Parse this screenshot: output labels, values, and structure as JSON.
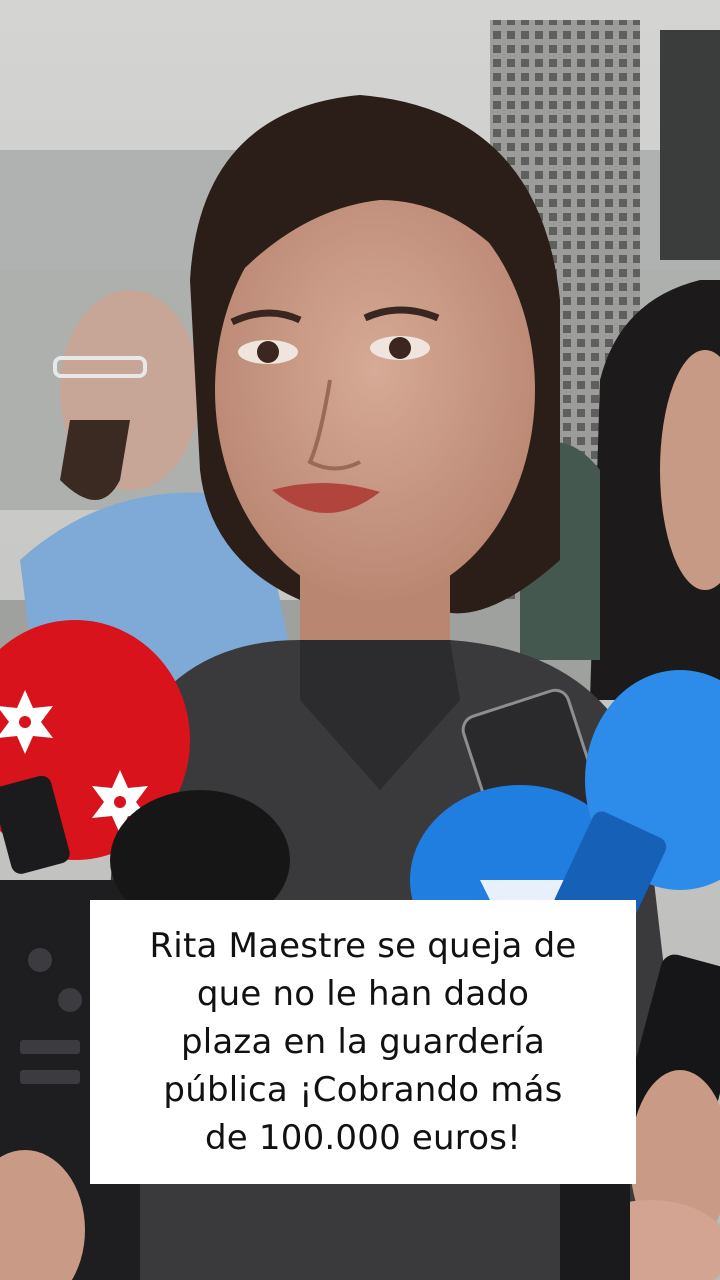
{
  "scene": {
    "description_hidden": "",
    "colors": {
      "wall": "#c9c9c8",
      "hair": "#2b1d17",
      "skin": "#c99a86",
      "shirt": "#3a3a3c",
      "mic_red": "#d8131b",
      "mic_blue": "#1f7ee0",
      "mic_blue_dark": "#1760b8"
    }
  },
  "caption": {
    "lines": [
      "Rita Maestre se queja de",
      "que no le han dado",
      "plaza en la guardería",
      "pública ¡Cobrando más",
      "de 100.000 euros!"
    ]
  }
}
